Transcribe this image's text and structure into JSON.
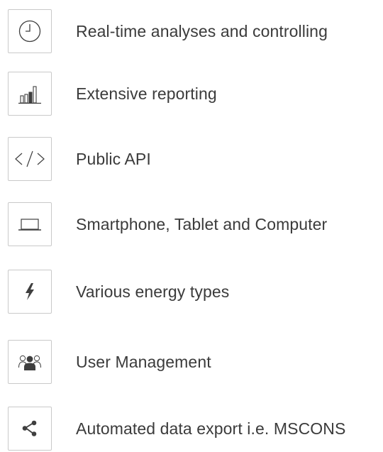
{
  "features": [
    {
      "icon": "clock-icon",
      "label": "Real-time analyses and controlling"
    },
    {
      "icon": "bar-chart-icon",
      "label": "Extensive reporting"
    },
    {
      "icon": "code-icon",
      "label": "Public API"
    },
    {
      "icon": "laptop-icon",
      "label": "Smartphone, Tablet and Computer"
    },
    {
      "icon": "lightning-icon",
      "label": "Various energy types"
    },
    {
      "icon": "users-icon",
      "label": "User Management"
    },
    {
      "icon": "share-icon",
      "label": "Automated data export i.e. MSCONS"
    }
  ],
  "colors": {
    "text": "#3b3b3b",
    "icon": "#3f3f3f",
    "border": "#c9c9c9",
    "background": "#ffffff"
  }
}
